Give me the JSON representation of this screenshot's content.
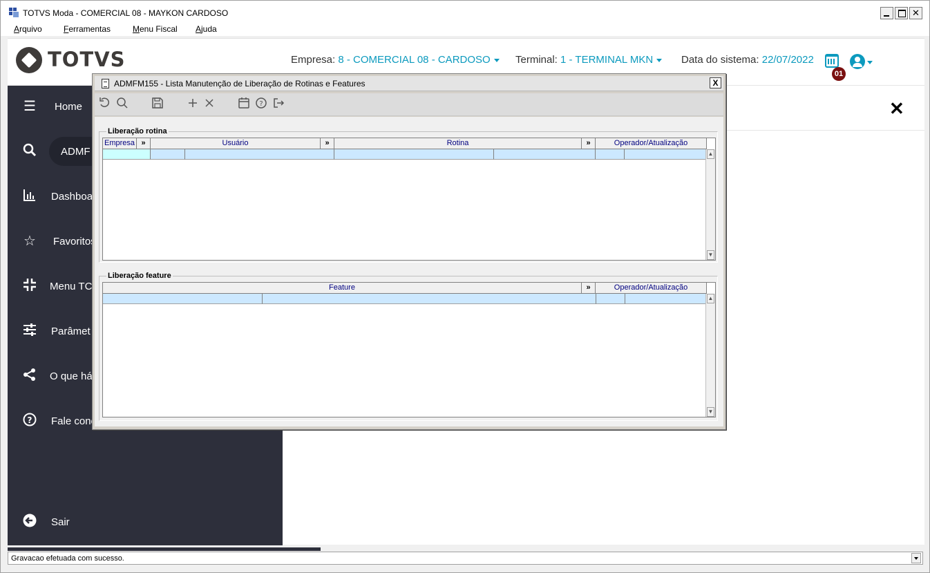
{
  "window": {
    "title": "TOTVS Moda - COMERCIAL 08 - MAYKON CARDOSO",
    "close": "✕"
  },
  "menu": {
    "items": [
      "Arquivo",
      "Ferramentas",
      "Menu Fiscal",
      "Ajuda"
    ]
  },
  "header": {
    "logo": "TOTVS",
    "empresa_label": "Empresa:",
    "empresa_value": "8 - COMERCIAL 08 - CARDOSO",
    "terminal_label": "Terminal:",
    "terminal_value": "1 - TERMINAL MKN",
    "data_label": "Data do sistema:",
    "data_value": "22/07/2022",
    "badge": "01",
    "accent_color": "#0c9abe"
  },
  "sidebar": {
    "search_value": "ADMF",
    "items": [
      {
        "label": "Home",
        "icon": "menu-icon"
      },
      {
        "label": "Dashboa",
        "icon": "chart-icon"
      },
      {
        "label": "Favoritos",
        "icon": "star-icon"
      },
      {
        "label": "Menu TC",
        "icon": "collapse-icon"
      },
      {
        "label": "Parâmet",
        "icon": "sliders-icon"
      },
      {
        "label": "O que há",
        "icon": "share-icon"
      },
      {
        "label": "Fale cone",
        "icon": "help-icon"
      },
      {
        "label": "Sair",
        "icon": "exit-icon"
      }
    ]
  },
  "page": {
    "close": "✕"
  },
  "dialog": {
    "title": "ADMFM155 - Lista Manutenção de Liberação de Rotinas e Features",
    "close": "X",
    "toolbar": [
      "undo-icon",
      "search-icon",
      "save-icon",
      "add-icon",
      "delete-icon",
      "calendar-icon",
      "help-icon",
      "exit-icon"
    ],
    "group1": {
      "label": "Liberação rotina",
      "columns": [
        "Empresa",
        "»",
        "Usuário",
        "»",
        "Rotina",
        "»",
        "Operador/Atualização"
      ]
    },
    "group2": {
      "label": "Liberação feature",
      "columns": [
        "Feature",
        "»",
        "Operador/Atualização"
      ]
    }
  },
  "status": {
    "message": "Gravacao efetuada com sucesso."
  }
}
